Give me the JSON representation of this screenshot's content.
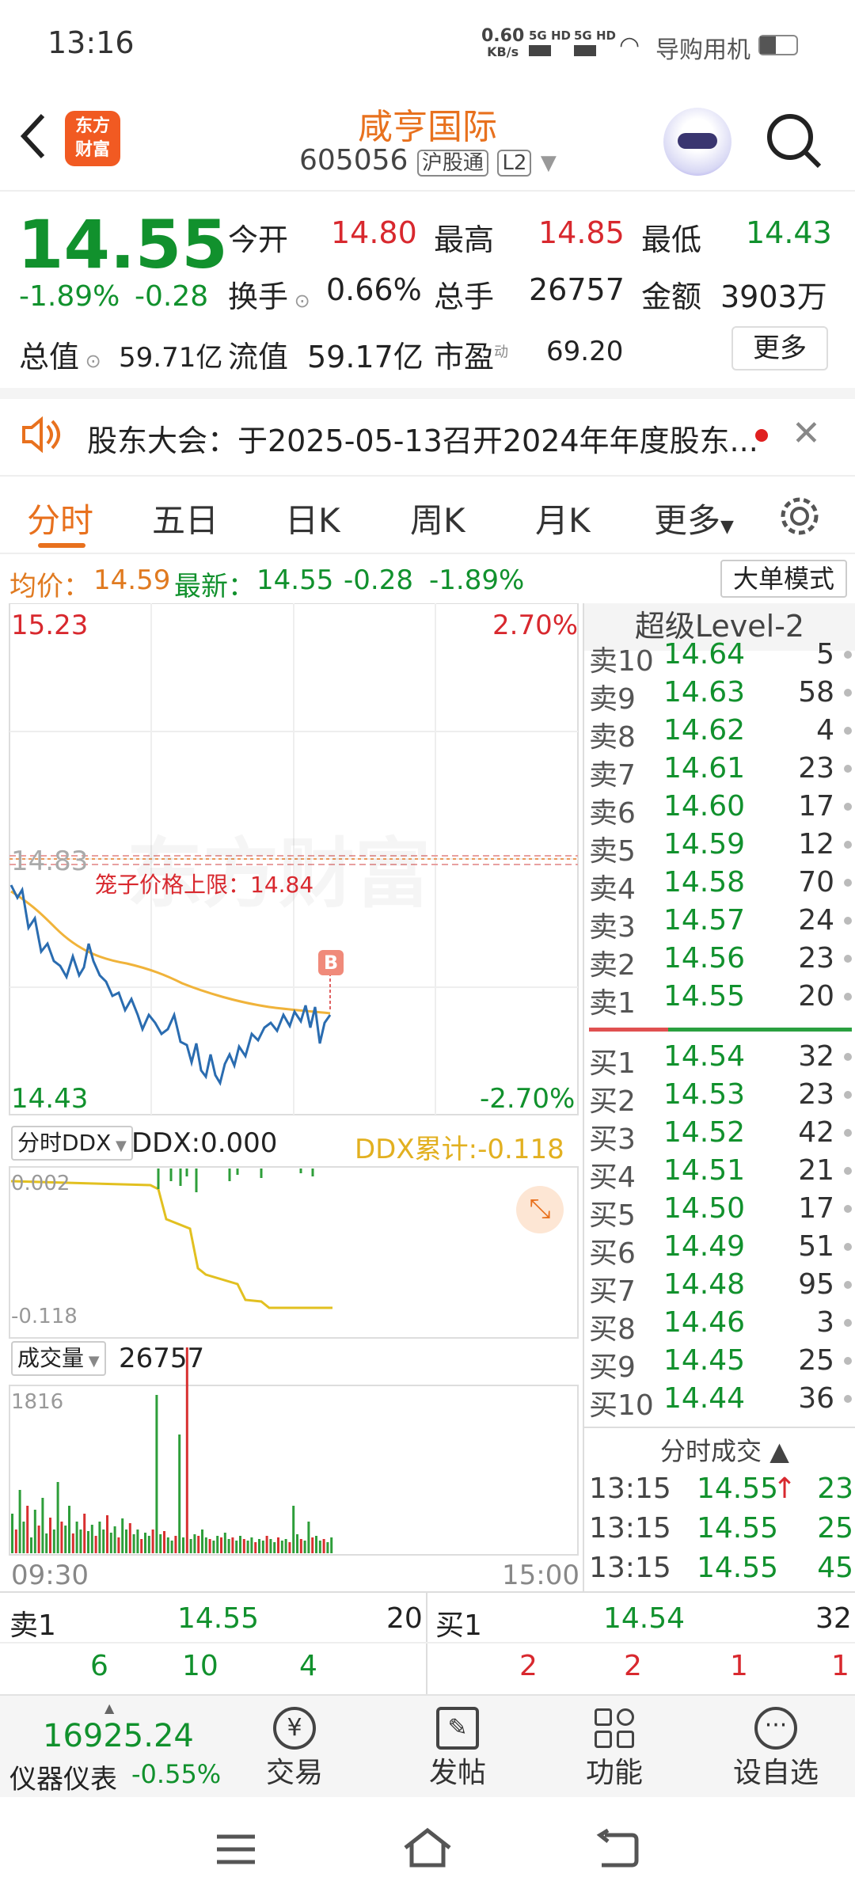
{
  "status": {
    "time": "13:16",
    "speed_value": "0.60",
    "speed_unit": "KB/s",
    "net1": "5G HD",
    "net2": "5G HD",
    "app_label": "导购用机"
  },
  "header": {
    "stock_name": "咸亨国际",
    "code": "605056",
    "market_tag": "沪股通",
    "level_tag": "L2",
    "logo_text_1": "东方",
    "logo_text_2": "财富"
  },
  "quote": {
    "price": "14.55",
    "change_pct": "-1.89%",
    "change": "-0.28",
    "open_label": "今开",
    "open": "14.80",
    "high_label": "最高",
    "high": "14.85",
    "low_label": "最低",
    "low": "14.43",
    "turnover_label": "换手",
    "turnover": "0.66%",
    "volume_label": "总手",
    "volume": "26757",
    "amount_label": "金额",
    "amount": "3903万",
    "mcap_label": "总值",
    "mcap": "59.71亿",
    "float_label": "流值",
    "float": "59.17亿",
    "pe_label": "市盈",
    "pe_sup": "动",
    "pe": "69.20",
    "more": "更多"
  },
  "notice": {
    "text": "股东大会：于2025-05-13召开2024年年度股东..."
  },
  "tabs": [
    "分时",
    "五日",
    "日K",
    "周K",
    "月K",
    "更多"
  ],
  "info": {
    "avg_label": "均价：",
    "avg": "14.59",
    "latest_label": "最新：",
    "latest": "14.55",
    "chg": "-0.28",
    "pct": "-1.89%",
    "big_order": "大单模式"
  },
  "chart": {
    "y_top": "15.23",
    "y_top_pct": "2.70%",
    "y_bottom": "14.43",
    "y_bottom_pct": "-2.70%",
    "cage_level": "14.83",
    "cage_label": "笼子价格上限：14.84",
    "watermark": "东方财富",
    "marker": "B",
    "ddx_select": "分时DDX",
    "ddx": "DDX:0.000",
    "ddx_cum": "DDX累计:-0.118",
    "ddx_top": "0.002",
    "ddx_bottom": "-0.118",
    "vol_select": "成交量",
    "vol": "26757",
    "vol_max": "1816",
    "t_start": "09:30",
    "t_end": "15:00"
  },
  "book": {
    "title": "超级Level-2",
    "asks": [
      {
        "l": "卖10",
        "p": "14.64",
        "v": "5"
      },
      {
        "l": "卖9",
        "p": "14.63",
        "v": "58"
      },
      {
        "l": "卖8",
        "p": "14.62",
        "v": "4"
      },
      {
        "l": "卖7",
        "p": "14.61",
        "v": "23"
      },
      {
        "l": "卖6",
        "p": "14.60",
        "v": "17"
      },
      {
        "l": "卖5",
        "p": "14.59",
        "v": "12"
      },
      {
        "l": "卖4",
        "p": "14.58",
        "v": "70"
      },
      {
        "l": "卖3",
        "p": "14.57",
        "v": "24"
      },
      {
        "l": "卖2",
        "p": "14.56",
        "v": "23"
      },
      {
        "l": "卖1",
        "p": "14.55",
        "v": "20"
      }
    ],
    "bids": [
      {
        "l": "买1",
        "p": "14.54",
        "v": "32"
      },
      {
        "l": "买2",
        "p": "14.53",
        "v": "23"
      },
      {
        "l": "买3",
        "p": "14.52",
        "v": "42"
      },
      {
        "l": "买4",
        "p": "14.51",
        "v": "21"
      },
      {
        "l": "买5",
        "p": "14.50",
        "v": "17"
      },
      {
        "l": "买6",
        "p": "14.49",
        "v": "51"
      },
      {
        "l": "买7",
        "p": "14.48",
        "v": "95"
      },
      {
        "l": "买8",
        "p": "14.46",
        "v": "3"
      },
      {
        "l": "买9",
        "p": "14.45",
        "v": "25"
      },
      {
        "l": "买10",
        "p": "14.44",
        "v": "36"
      }
    ],
    "ticks_title": "分时成交",
    "ticks": [
      {
        "t": "13:15",
        "p": "14.55",
        "v": "23"
      },
      {
        "t": "13:15",
        "p": "14.55",
        "v": "25"
      },
      {
        "t": "13:15",
        "p": "14.55",
        "v": "45"
      }
    ]
  },
  "bottom": {
    "ask_label": "卖1",
    "ask_price": "14.55",
    "ask_vol": "20",
    "bid_label": "买1",
    "bid_price": "14.54",
    "bid_vol": "32",
    "ask_queue": [
      "6",
      "10",
      "4"
    ],
    "bid_queue": [
      "2",
      "2",
      "1",
      "1"
    ]
  },
  "nav": {
    "index_value": "16925.24",
    "index_name": "仪器仪表",
    "index_pct": "-0.55%",
    "trade": "交易",
    "post": "发帖",
    "func": "功能",
    "watch": "设自选"
  }
}
